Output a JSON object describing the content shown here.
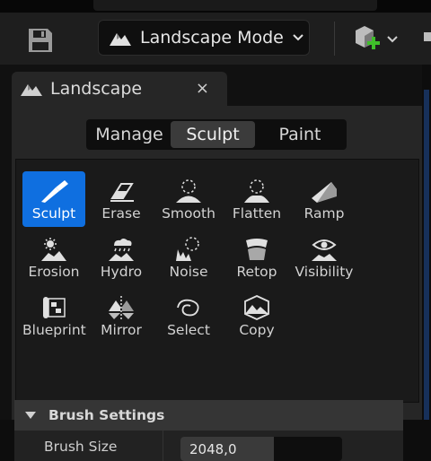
{
  "toolbar": {
    "mode_label": "Landscape Mode",
    "save_icon": "save-icon",
    "add_icon": "add-actor-icon"
  },
  "panel": {
    "tab_title": "Landscape",
    "close_glyph": "×",
    "modes": [
      {
        "label": "Manage",
        "active": false
      },
      {
        "label": "Sculpt",
        "active": true
      },
      {
        "label": "Paint",
        "active": false
      }
    ],
    "tools": [
      {
        "label": "Sculpt",
        "icon": "sculpt-brush-icon",
        "active": true
      },
      {
        "label": "Erase",
        "icon": "erase-icon",
        "active": false
      },
      {
        "label": "Smooth",
        "icon": "smooth-icon",
        "active": false
      },
      {
        "label": "Flatten",
        "icon": "flatten-icon",
        "active": false
      },
      {
        "label": "Ramp",
        "icon": "ramp-icon",
        "active": false
      },
      {
        "label": "Erosion",
        "icon": "erosion-icon",
        "active": false
      },
      {
        "label": "Hydro",
        "icon": "hydro-icon",
        "active": false
      },
      {
        "label": "Noise",
        "icon": "noise-icon",
        "active": false
      },
      {
        "label": "Retop",
        "icon": "retop-icon",
        "active": false
      },
      {
        "label": "Visibility",
        "icon": "visibility-icon",
        "active": false
      },
      {
        "label": "Blueprint",
        "icon": "blueprint-icon",
        "active": false
      },
      {
        "label": "Mirror",
        "icon": "mirror-icon",
        "active": false
      },
      {
        "label": "Select",
        "icon": "select-icon",
        "active": false
      },
      {
        "label": "Copy",
        "icon": "copy-icon",
        "active": false
      }
    ],
    "brush_settings": {
      "title": "Brush Settings",
      "brush_size_label": "Brush Size",
      "brush_size_value": "2048,0"
    }
  },
  "colors": {
    "accent": "#0f6fe0",
    "add_green": "#3fbf2a"
  }
}
